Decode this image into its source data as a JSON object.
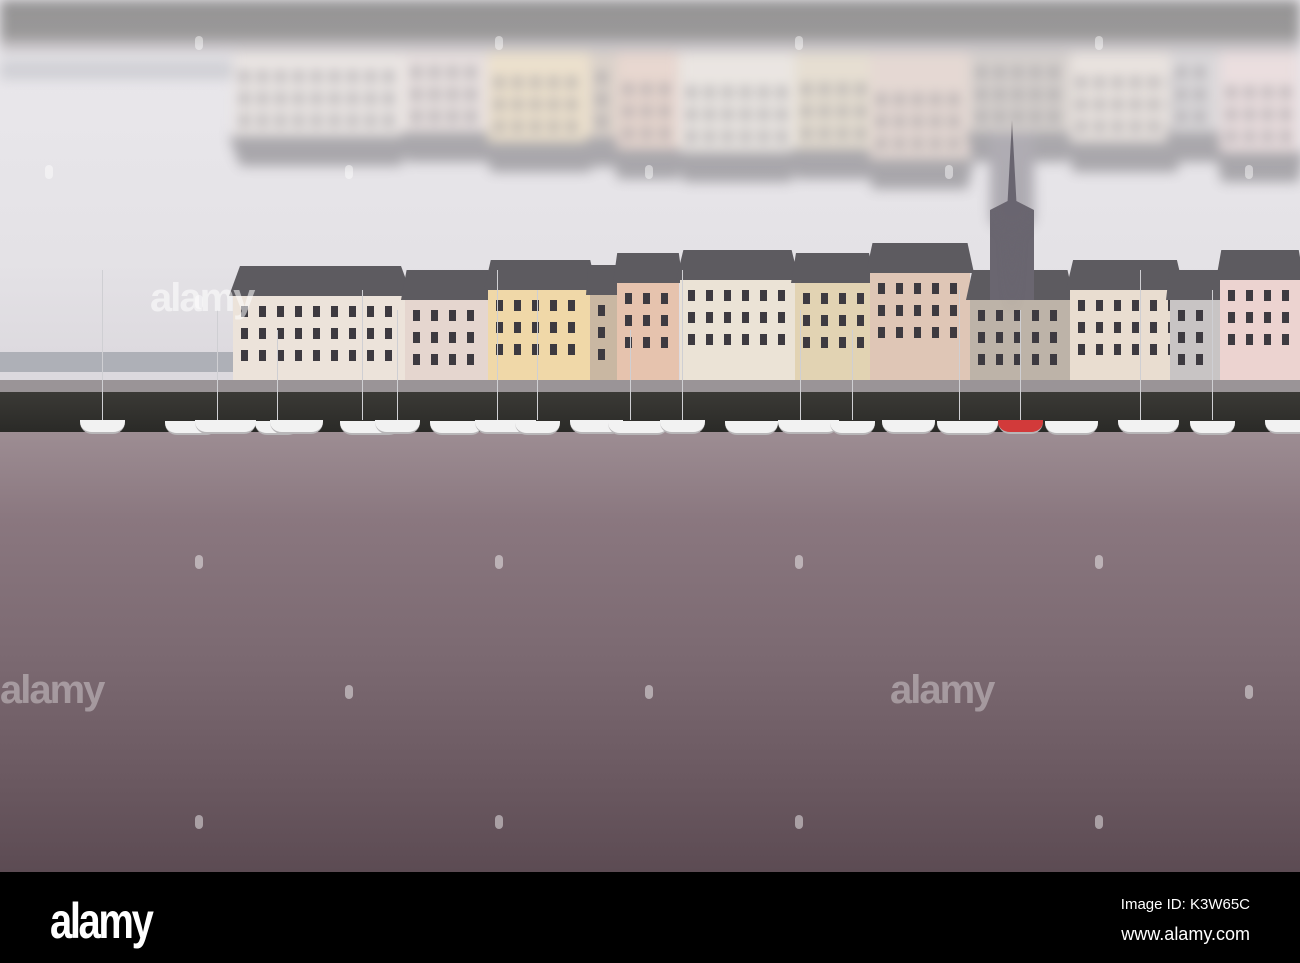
{
  "watermark": {
    "brand": "alamy"
  },
  "footer": {
    "logo": "alamy",
    "image_id": "Image ID: K3W65C",
    "website": "www.alamy.com"
  },
  "colors": {
    "sky": "#e6e4e8",
    "water": "#7c6a72",
    "footer": "#000000"
  }
}
